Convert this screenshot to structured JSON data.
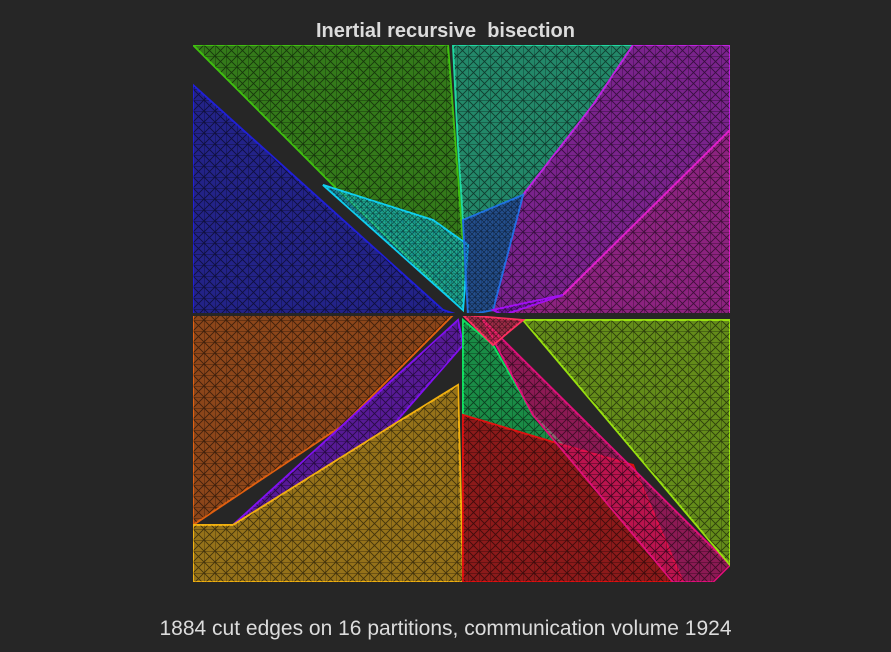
{
  "title": "Inertial recursive  bisection",
  "caption": "1884 cut edges on 16 partitions, communication volume 1924",
  "background_color": "#262626",
  "text_color": "#dcdcdc",
  "chart_data": {
    "type": "mesh partition",
    "partitions": [
      {
        "id": 1,
        "color": "#40c010"
      },
      {
        "id": 2,
        "color": "#20d8a0"
      },
      {
        "id": 3,
        "color": "#c020e0"
      },
      {
        "id": 4,
        "color": "#e020c8"
      },
      {
        "id": 5,
        "color": "#2020d8"
      },
      {
        "id": 6,
        "color": "#10d0f0"
      },
      {
        "id": 7,
        "color": "#2070e0"
      },
      {
        "id": 8,
        "color": "#a010f0"
      },
      {
        "id": 9,
        "color": "#e06010"
      },
      {
        "id": 10,
        "color": "#8010f0"
      },
      {
        "id": 11,
        "color": "#f0b010"
      },
      {
        "id": 12,
        "color": "#10e060"
      },
      {
        "id": 13,
        "color": "#e01010"
      },
      {
        "id": 14,
        "color": "#e0107a"
      },
      {
        "id": 15,
        "color": "#98e010"
      },
      {
        "id": 16,
        "color": "#ff3060"
      }
    ]
  }
}
